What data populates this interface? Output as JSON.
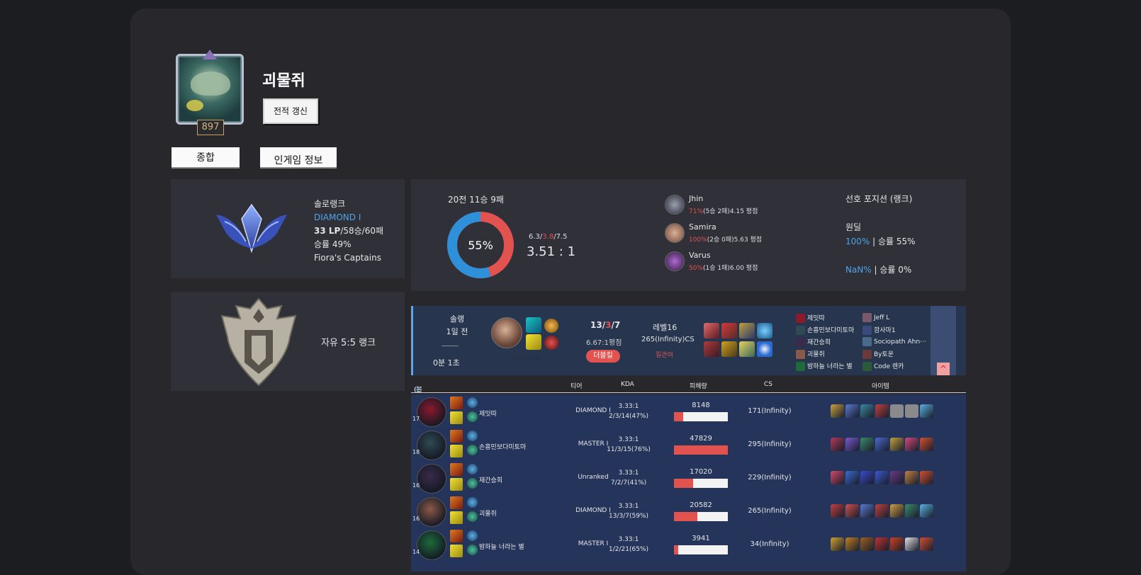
{
  "profile": {
    "summoner_name": "괴물쥐",
    "level": "897",
    "refresh_label": "전적 갱신"
  },
  "tabs": [
    "종합",
    "인게임 정보"
  ],
  "solo_rank": {
    "queue": "솔로랭크",
    "tier": "DIAMOND Ⅰ",
    "lp": "33 LP",
    "record": "/58승/60패",
    "winrate": "승률 49%",
    "league": "Fiora's Captains"
  },
  "flex_rank": {
    "label": "자유 5:5 랭크"
  },
  "summary": {
    "record": "20전 11승 9패",
    "winrate_label": "55%",
    "winrate": 55,
    "kda_k": "6.3",
    "kda_d": "3.8",
    "kda_a": "7.5",
    "kda_ratio": "3.51 : 1",
    "champions": [
      {
        "name": "Jhin",
        "pct": "71%",
        "detail": "(5승 2패)4.15 평점"
      },
      {
        "name": "Samira",
        "pct": "100%",
        "detail": "(2승 0패)5.63 평점"
      },
      {
        "name": "Varus",
        "pct": "50%",
        "detail": "(1승 1패)6.00 평점"
      }
    ],
    "position_title": "선호 포지션 (랭크)",
    "position_name": "원딜",
    "position_pct": "100%",
    "position_winrate": "| 승률 55%",
    "position2_pct": "NaN%",
    "position2_winrate": "| 승률 0%"
  },
  "match": {
    "queue": "솔랭",
    "time_ago": "1일 전",
    "duration": "0분 1초",
    "champion": "Samira",
    "kda_k": "13",
    "kda_d": "3",
    "kda_a": "7",
    "ratio": "6.67:1평점",
    "multikill": "더블킬",
    "level": "레벨16",
    "cs": "265(Infinity)CS",
    "kill_participation": "킬관여",
    "team1": [
      "제잇따",
      "손흥민보다미토마",
      "재간승희",
      "괴물쥐",
      "밤하늘 너라는 별"
    ],
    "team2": [
      "Jeff L",
      "깜사마1",
      "Sociopath Ahn⋯",
      "By토운",
      "Code 렌카"
    ],
    "expand_icon": "^"
  },
  "detail": {
    "team_result": "승리",
    "team_name": "(블루팀)",
    "headers": {
      "tier": "티어",
      "kda": "KDA",
      "damage": "피해량",
      "cs": "CS",
      "items": "아이템"
    },
    "rows": [
      {
        "level": "17",
        "name": "제잇따",
        "tier": "DIAMOND Ⅰ",
        "kda_ratio": "3.33:1",
        "kda": "2/3/14(47%)",
        "damage": "8148",
        "damage_value": 8148,
        "cs": "171(Infinity)",
        "color": "#8a1a2c"
      },
      {
        "level": "18",
        "name": "손흥민보다미토마",
        "tier": "MASTER Ⅰ",
        "kda_ratio": "3.33:1",
        "kda": "11/3/15(76%)",
        "damage": "47829",
        "damage_value": 47829,
        "cs": "295(Infinity)",
        "color": "#2f4a52"
      },
      {
        "level": "16",
        "name": "재간승희",
        "tier": "Unranked",
        "kda_ratio": "3.33:1",
        "kda": "7/2/7(41%)",
        "damage": "17020",
        "damage_value": 17020,
        "cs": "229(Infinity)",
        "color": "#3a2b4a"
      },
      {
        "level": "16",
        "name": "괴물쥐",
        "tier": "DIAMOND Ⅰ",
        "kda_ratio": "3.33:1",
        "kda": "13/3/7(59%)",
        "damage": "20582",
        "damage_value": 20582,
        "cs": "265(Infinity)",
        "color": "#8a5a48"
      },
      {
        "level": "14",
        "name": "밤하늘 너라는 별",
        "tier": "MASTER Ⅰ",
        "kda_ratio": "3.33:1",
        "kda": "1/2/21(65%)",
        "damage": "3941",
        "damage_value": 3941,
        "cs": "34(Infinity)",
        "color": "#1d6b3a"
      }
    ]
  },
  "colors": {
    "win_blue": "#4fa3e6",
    "loss_red": "#e2524f",
    "panel": "#303039",
    "match_bg": "#27354e"
  }
}
